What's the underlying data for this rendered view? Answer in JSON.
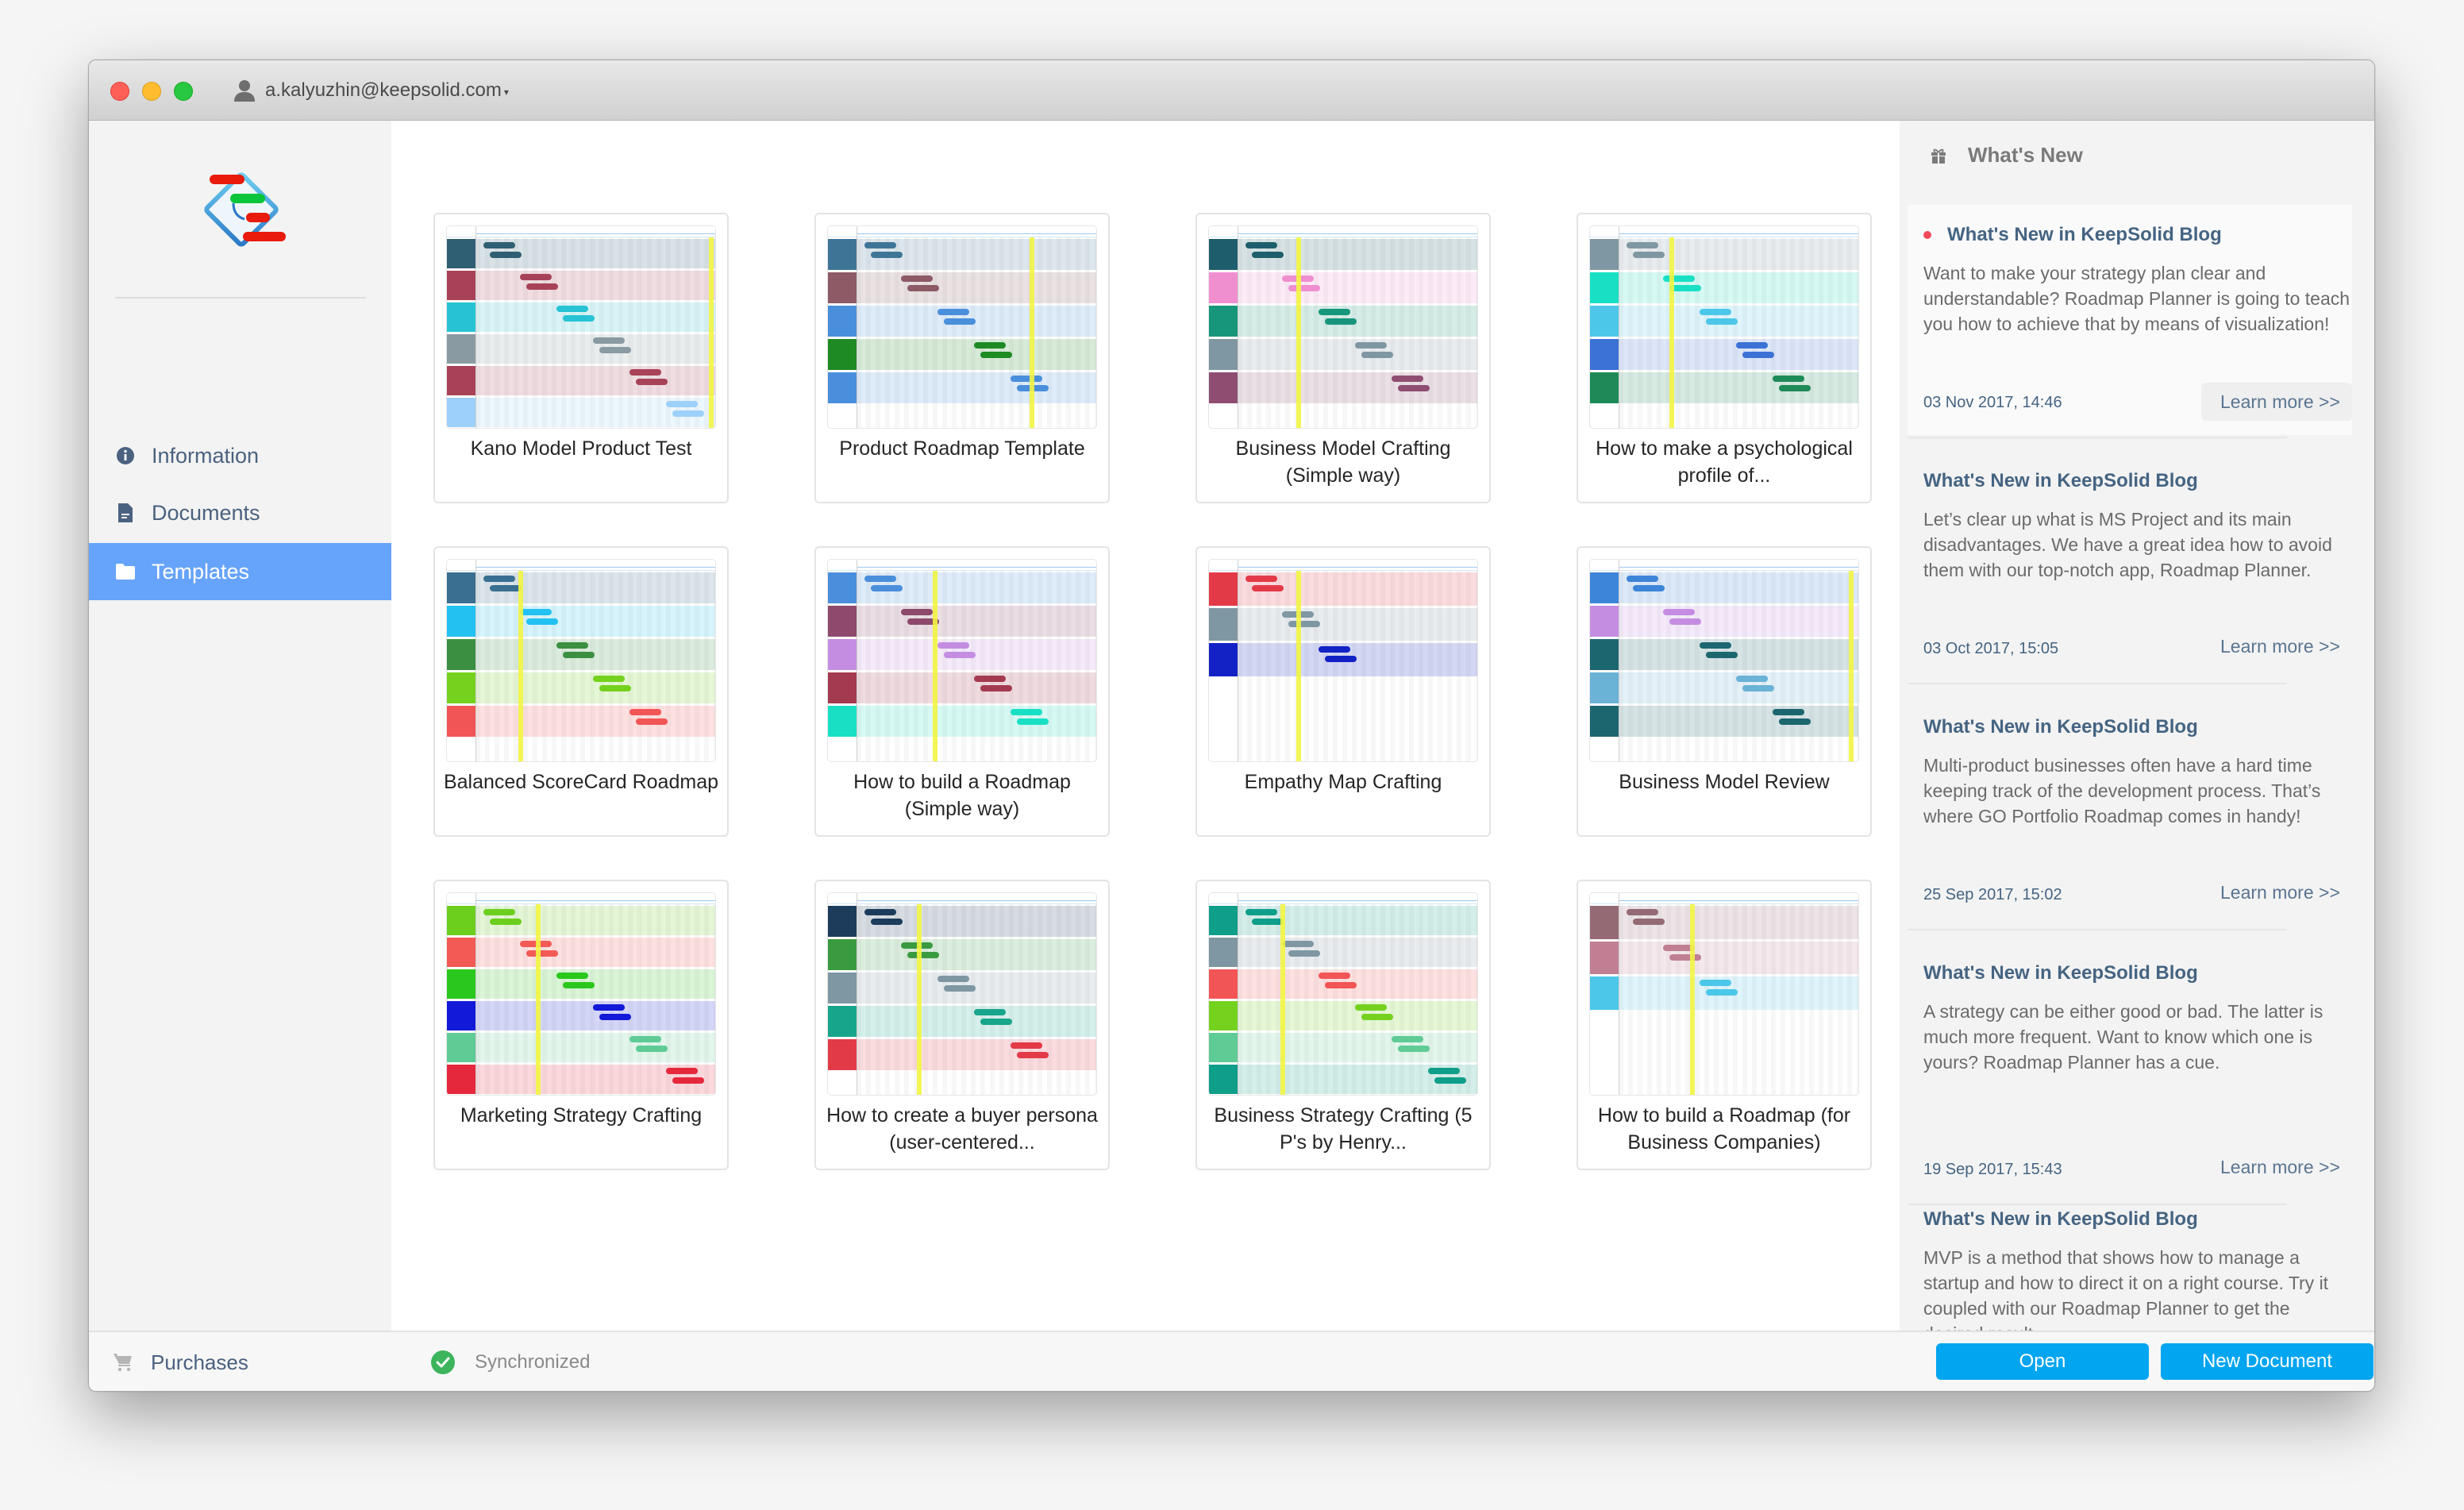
{
  "titlebar": {
    "account_email": "a.kalyuzhin@keepsolid.com",
    "account_caret": "▾",
    "traffic_lights": [
      "close",
      "minimize",
      "zoom"
    ]
  },
  "sidebar": {
    "logo": "roadmap-planner-logo",
    "items": [
      {
        "label": "Information",
        "icon": "info-icon",
        "active": false
      },
      {
        "label": "Documents",
        "icon": "document-icon",
        "active": false
      },
      {
        "label": "Templates",
        "icon": "folder-icon",
        "active": true
      }
    ],
    "accent_color": "#66a3fa"
  },
  "templates": [
    {
      "title": "Kano Model Product Test",
      "lanes": [
        "#2f5f73",
        "#a84258",
        "#27c3d4",
        "#8a9aa2",
        "#a84258",
        "#9dd0fb"
      ]
    },
    {
      "title": "Product Roadmap Template",
      "lanes": [
        "#3e7597",
        "#8d5a66",
        "#4a8fdc",
        "#1e8a24",
        "#4a8fdc"
      ]
    },
    {
      "title": "Business Model Crafting (Simple way)",
      "lanes": [
        "#1e5e6c",
        "#f08fd0",
        "#17967c",
        "#7f97a2",
        "#8f4d72"
      ]
    },
    {
      "title": "How to make a psychological profile of...",
      "lanes": [
        "#7f97a2",
        "#19e0c4",
        "#4cc7e9",
        "#3c72d6",
        "#1d8a58"
      ]
    },
    {
      "title": "Balanced ScoreCard Roadmap",
      "lanes": [
        "#3a6f92",
        "#22c1f2",
        "#3a8f40",
        "#74d21e",
        "#f25555"
      ]
    },
    {
      "title": "How to build a Roadmap (Simple way)",
      "lanes": [
        "#4a8fdc",
        "#8d4a6c",
        "#c48de2",
        "#a43a50",
        "#19e0c4"
      ]
    },
    {
      "title": "Empathy Map Crafting",
      "lanes": [
        "#e33a48",
        "#7f97a2",
        "#1222c4"
      ]
    },
    {
      "title": "Business Model Review",
      "lanes": [
        "#3d85d8",
        "#c48de2",
        "#1c6670",
        "#6ab2d6",
        "#1c6670"
      ]
    },
    {
      "title": "Marketing Strategy Crafting",
      "lanes": [
        "#6ccf1e",
        "#f25a55",
        "#2ac81c",
        "#1219d8",
        "#5fcb95",
        "#e6283c"
      ]
    },
    {
      "title": "How to create a buyer persona (user-centered...",
      "lanes": [
        "#1d3c5c",
        "#3a9a40",
        "#7f97a2",
        "#17a58c",
        "#e33a48"
      ]
    },
    {
      "title": "Business Strategy Crafting (5 P's by Henry...",
      "lanes": [
        "#0f9e8a",
        "#7f97a2",
        "#f25555",
        "#74d21e",
        "#5fcb95",
        "#0f9e8a"
      ]
    },
    {
      "title": "How to build a Roadmap (for Business Companies)",
      "lanes": [
        "#946a74",
        "#c07f93",
        "#4cc7e9"
      ]
    }
  ],
  "whats_new": {
    "header": "What's New",
    "header_icon": "gift-icon",
    "items": [
      {
        "title": "What's New in KeepSolid Blog",
        "unread": true,
        "body": "Want to make your strategy plan clear and understandable? Roadmap Planner is going to teach you how to achieve that by means of visualization!",
        "date": "03 Nov 2017, 14:46",
        "link": "Learn more >>"
      },
      {
        "title": "What's New in KeepSolid Blog",
        "unread": false,
        "body": "Let’s clear up what is MS Project and its main disadvantages. We have a great idea how to avoid them with our top-notch app, Roadmap Planner.",
        "date": "03 Oct 2017, 15:05",
        "link": "Learn more >>"
      },
      {
        "title": "What's New in KeepSolid Blog",
        "unread": false,
        "body": "Multi-product businesses often have a hard time keeping track of the development process. That’s where GO Portfolio Roadmap comes in handy!",
        "date": "25 Sep 2017, 15:02",
        "link": "Learn more >>"
      },
      {
        "title": "What's New in KeepSolid Blog",
        "unread": false,
        "body": "A strategy can be either good or bad. The latter is much more frequent. Want to know which one is yours? Roadmap Planner has a cue.",
        "date": "19 Sep 2017, 15:43",
        "link": "Learn more >>"
      },
      {
        "title": "What's New in KeepSolid Blog",
        "unread": false,
        "body": "MVP is a method that shows how to manage a startup and how to direct it on a right course. Try it coupled with our Roadmap Planner to get the desired result.",
        "date": "",
        "link": ""
      }
    ]
  },
  "footer": {
    "purchases_label": "Purchases",
    "sync_status": "Synchronized",
    "open_label": "Open",
    "new_document_label": "New Document",
    "button_color": "#02a5ef"
  }
}
